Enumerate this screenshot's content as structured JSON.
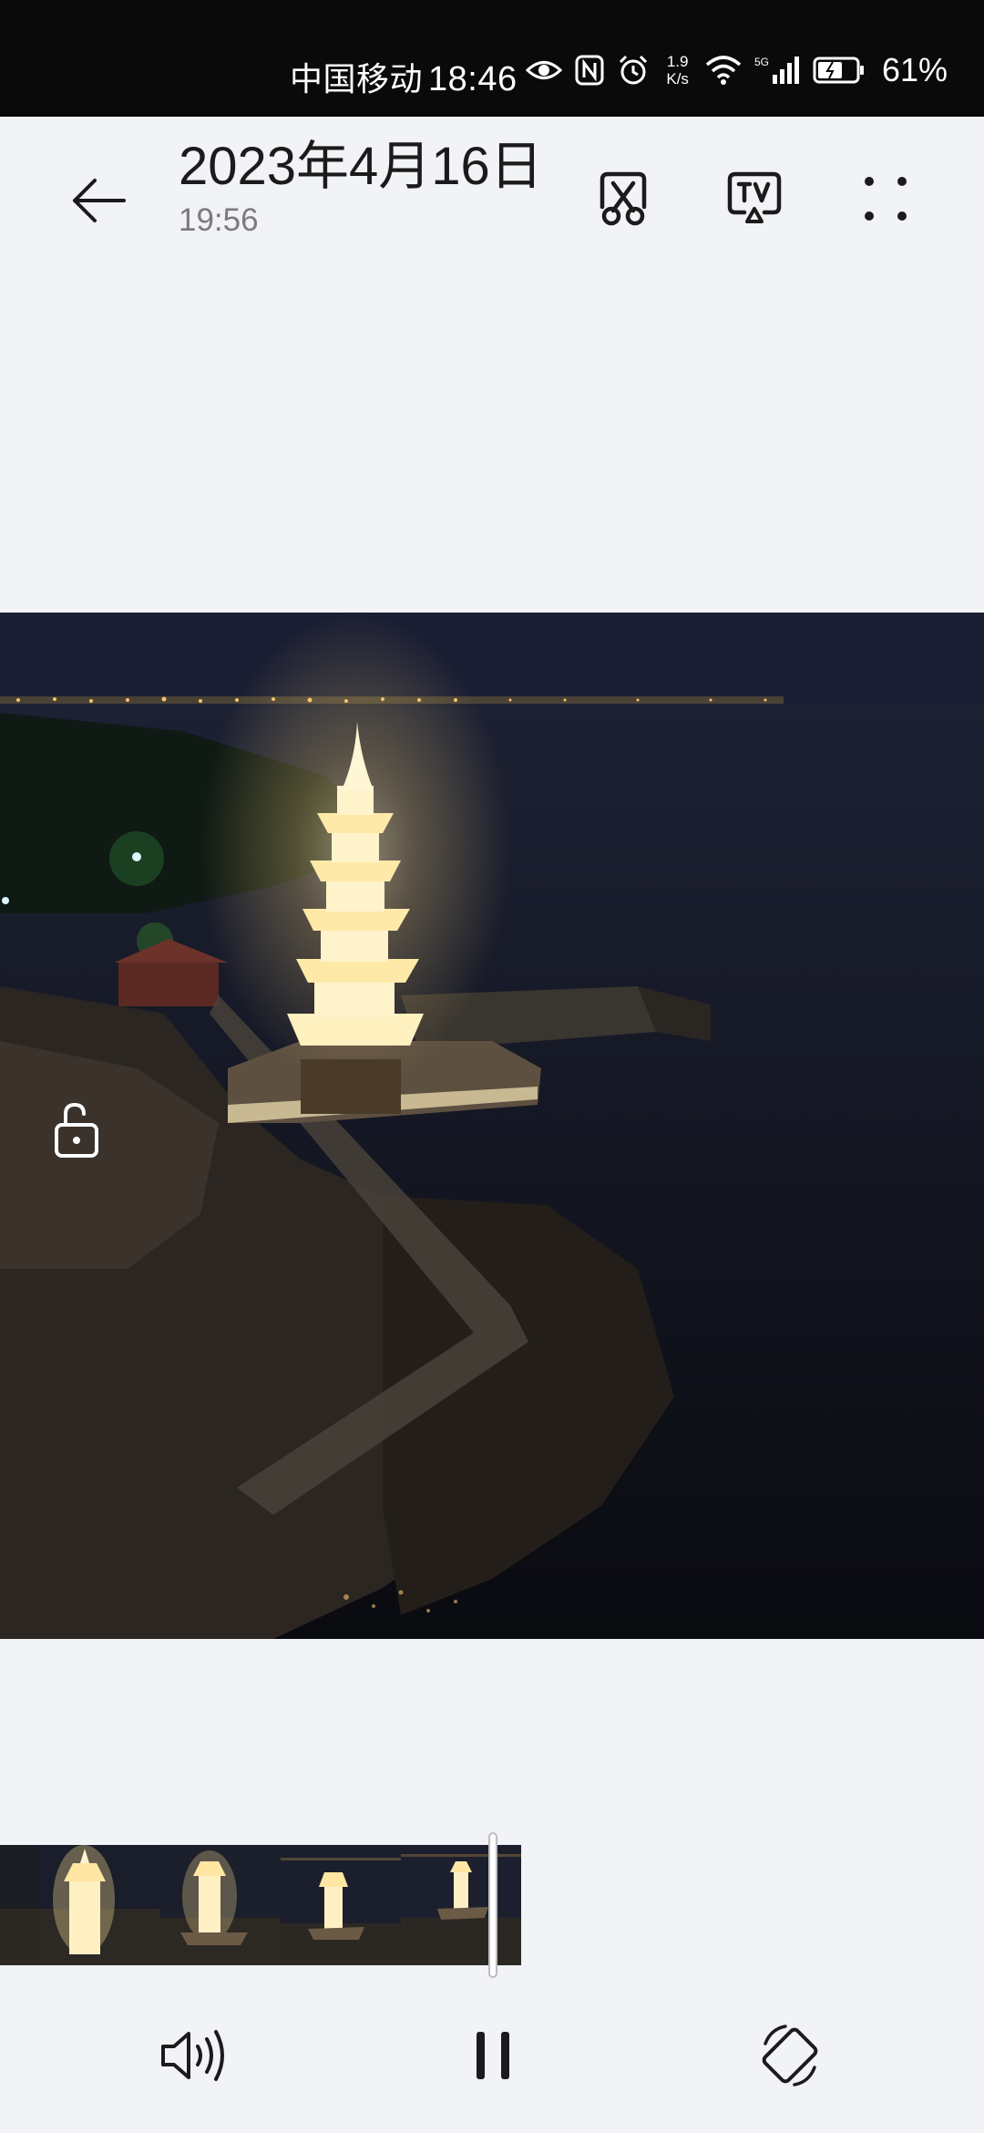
{
  "status_bar": {
    "carrier": "中国移动",
    "time": "18:46",
    "network_speed_value": "1.9",
    "network_speed_unit": "K/s",
    "network_type": "5G",
    "battery_percent": "61%",
    "icons": [
      "eye-icon",
      "nfc-icon",
      "alarm-icon",
      "wifi-icon",
      "signal-icon",
      "battery-icon"
    ]
  },
  "header": {
    "title": "2023年4月16日",
    "subtitle": "19:56",
    "actions": [
      {
        "name": "edit",
        "icon": "scissors-icon"
      },
      {
        "name": "cast",
        "icon": "tv-cast-icon"
      },
      {
        "name": "more",
        "icon": "more-dots-icon"
      }
    ]
  },
  "video": {
    "description_icon": "lock-open-icon"
  },
  "timeline": {
    "thumbnail_count": 5
  },
  "controls": {
    "volume_icon": "volume-icon",
    "play_state_icon": "pause-icon",
    "rotate_icon": "rotate-screen-icon"
  },
  "colors": {
    "background": "#f1f3f6",
    "status_bar": "#0a0a0a",
    "text_primary": "#1b1b1b",
    "text_secondary": "#7b7b7b"
  }
}
